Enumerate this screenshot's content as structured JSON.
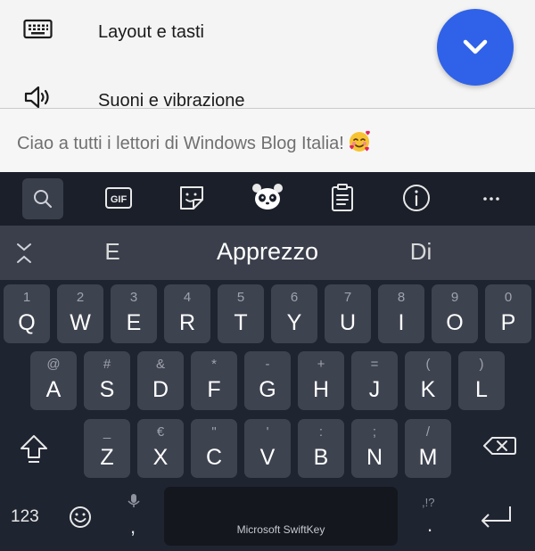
{
  "settings": {
    "items": [
      {
        "label": "Layout e tasti",
        "icon": "keyboard-icon"
      },
      {
        "label": "Suoni e vibrazione",
        "icon": "speaker-icon"
      }
    ],
    "fab_icon": "chevron-down-icon",
    "colors": {
      "fab": "#2f62e8",
      "background": "#f4f4f4"
    }
  },
  "text_field": {
    "value": "Ciao a tutti i lettori di Windows Blog Italia!",
    "emoji": "smiling-face-with-hearts"
  },
  "toolbar": {
    "buttons": [
      "search-icon",
      "gif-icon",
      "sticker-icon",
      "panda-icon",
      "clipboard-icon",
      "info-icon",
      "more-icon"
    ],
    "gif_label": "GIF"
  },
  "suggestions": {
    "left": "E",
    "center": "Apprezzo",
    "right": "Di"
  },
  "keyboard": {
    "row1": [
      {
        "hint": "1",
        "key": "Q"
      },
      {
        "hint": "2",
        "key": "W"
      },
      {
        "hint": "3",
        "key": "E"
      },
      {
        "hint": "4",
        "key": "R"
      },
      {
        "hint": "5",
        "key": "T"
      },
      {
        "hint": "6",
        "key": "Y"
      },
      {
        "hint": "7",
        "key": "U"
      },
      {
        "hint": "8",
        "key": "I"
      },
      {
        "hint": "9",
        "key": "O"
      },
      {
        "hint": "0",
        "key": "P"
      }
    ],
    "row2": [
      {
        "hint": "@",
        "key": "A"
      },
      {
        "hint": "#",
        "key": "S"
      },
      {
        "hint": "&",
        "key": "D"
      },
      {
        "hint": "*",
        "key": "F"
      },
      {
        "hint": "-",
        "key": "G"
      },
      {
        "hint": "+",
        "key": "H"
      },
      {
        "hint": "=",
        "key": "J"
      },
      {
        "hint": "(",
        "key": "K"
      },
      {
        "hint": ")",
        "key": "L"
      }
    ],
    "row3": [
      {
        "hint": "_",
        "key": "Z"
      },
      {
        "hint": "€",
        "key": "X"
      },
      {
        "hint": "\"",
        "key": "C"
      },
      {
        "hint": "'",
        "key": "V"
      },
      {
        "hint": ":",
        "key": "B"
      },
      {
        "hint": ";",
        "key": "N"
      },
      {
        "hint": "/",
        "key": "M"
      }
    ],
    "numbers_label": "123",
    "comma": ",",
    "period": ".",
    "period_hint": ",!?",
    "space_brand": "Microsoft SwiftKey",
    "colors": {
      "key": "#3e4350",
      "background": "#1f2431",
      "space": "#14171e"
    }
  }
}
